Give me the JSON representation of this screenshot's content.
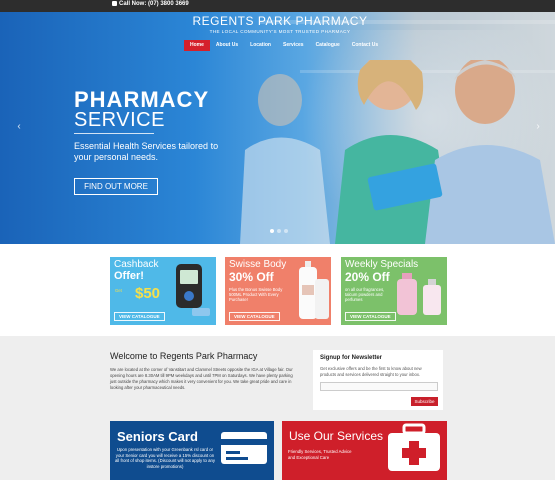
{
  "topbar": {
    "phone": "Call Now: (07) 3800 3669"
  },
  "brand": {
    "name": "REGENTS PARK PHARMACY",
    "tagline": "THE LOCAL COMMUNITY'S MOST TRUSTED PHARMACY"
  },
  "nav": {
    "items": [
      "Home",
      "About Us",
      "Location",
      "Services",
      "Catalogue",
      "Contact Us"
    ],
    "active": "Home"
  },
  "hero": {
    "title": "PHARMACY",
    "subtitle": "SERVICE",
    "description": "Essential Health Services tailored to your personal needs.",
    "button": "FIND OUT MORE",
    "prev_arrow": "‹",
    "next_arrow": "›"
  },
  "promos": [
    {
      "title": "Cashback",
      "big": "Offer!",
      "price": "$50",
      "price_prefix": "Get",
      "button": "VIEW CATALOGUE",
      "color": "#4fb9e8"
    },
    {
      "title": "Swisse Body",
      "big": "30% Off",
      "note": "Plus the Bonus Swisse Body 500ML Product With Every Purchase!",
      "button": "VIEW CATALOGUE",
      "color": "#f0806a"
    },
    {
      "title": "Weekly Specials",
      "big": "20% Off",
      "note": "on all our fragrances, talcum powders and perfumes",
      "button": "VIEW CATALOGUE",
      "color": "#7cc16a"
    }
  ],
  "welcome": {
    "title": "Welcome to Regents Park Pharmacy",
    "text": "We are located at the corner of Vanstitart and Clammel Streets opposite the IGA at Village fair. Our opening hours are 8.30AM till 9PM weekdays and until 7PM on Saturdays. We have plenty parking just outside the pharmacy which makes it very convenient for you. We take great pride and care in looking after your pharmaceutical needs."
  },
  "newsletter": {
    "title": "Signup for Newsletter",
    "text": "Get exclusive offers and be the first to know about new products and services delivered straight to your inbox.",
    "placeholder": "",
    "button": "Subscribe"
  },
  "banners": [
    {
      "title": "Seniors Card",
      "desc": "Upon presentation with your Greenbank rsl card or your Senior card you will receive a 15% discount on all front of shop items. (Discount will not apply to any instore promotions)",
      "color": "#0f4c8f"
    },
    {
      "title": "Use Our Services",
      "desc": "Friendly Services, Trusted Advice and Exceptional Care",
      "color": "#cf1f2a"
    }
  ]
}
